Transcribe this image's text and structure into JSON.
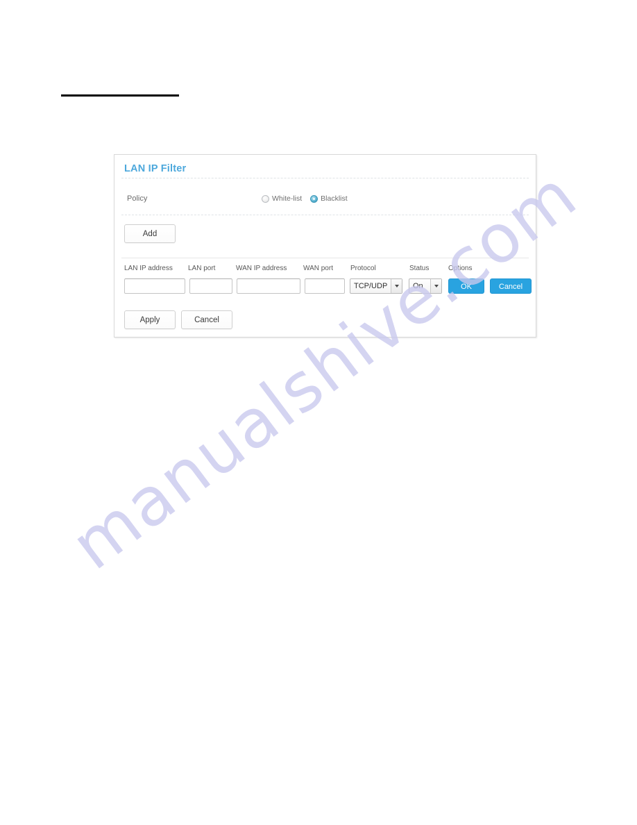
{
  "page": {
    "redaction_bar": "",
    "watermark": "manualshive.com"
  },
  "panel": {
    "title": "LAN IP Filter",
    "policy": {
      "label": "Policy",
      "options": [
        {
          "label": "White-list",
          "selected": false
        },
        {
          "label": "Blacklist",
          "selected": true
        }
      ]
    },
    "add_button": "Add",
    "table": {
      "headers": [
        "LAN IP address",
        "LAN port",
        "WAN IP address",
        "WAN port",
        "Protocol",
        "Status",
        "Options"
      ],
      "row": {
        "lan_ip_address": "",
        "lan_port": "",
        "wan_ip_address": "",
        "wan_port": "",
        "protocol": "TCP/UDP",
        "status": "On",
        "ok_label": "OK",
        "cancel_label": "Cancel"
      }
    },
    "footer": {
      "apply_label": "Apply",
      "cancel_label": "Cancel"
    }
  },
  "colors": {
    "title_blue": "#4da8dc",
    "button_blue": "#29a3e0",
    "radio_selected": "#2e8fb0",
    "watermark": "#c9c9ee"
  }
}
